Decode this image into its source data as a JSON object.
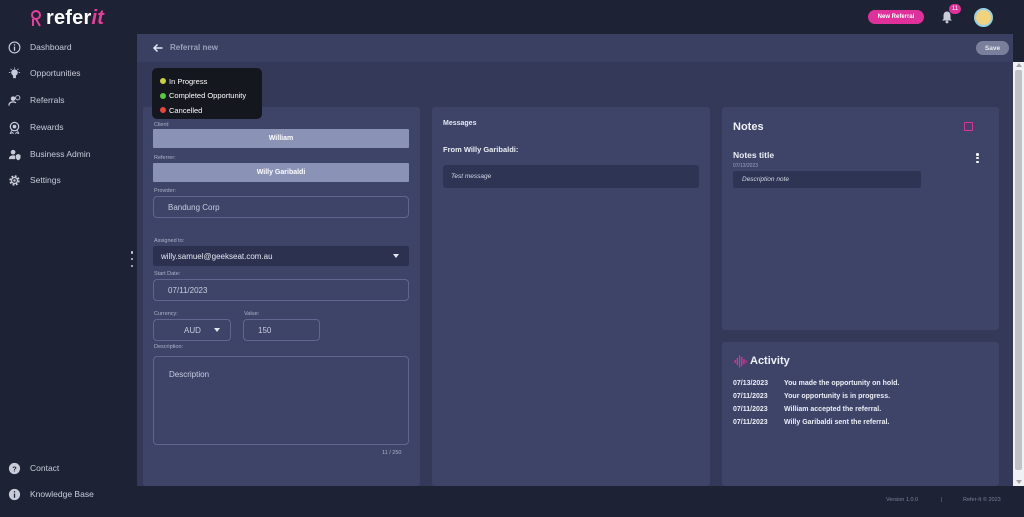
{
  "app": {
    "logo_main": "refer",
    "logo_accent": "it",
    "new_referral_label": "New Referral",
    "notification_count": "11"
  },
  "sidebar": {
    "items": [
      {
        "label": "Dashboard",
        "icon": "info-circle-icon"
      },
      {
        "label": "Opportunities",
        "icon": "lightbulb-icon"
      },
      {
        "label": "Referrals",
        "icon": "person-refresh-icon"
      },
      {
        "label": "Rewards",
        "icon": "award-icon"
      },
      {
        "label": "Business Admin",
        "icon": "shield-person-icon"
      },
      {
        "label": "Settings",
        "icon": "gear-icon"
      }
    ],
    "bottom_items": [
      {
        "label": "Contact",
        "icon": "question-circle-icon"
      },
      {
        "label": "Knowledge Base",
        "icon": "info-circle-icon"
      }
    ]
  },
  "header": {
    "title": "Referral new",
    "save_label": "Save"
  },
  "status_legend": [
    {
      "label": "In Progress",
      "color": "#c8d23a"
    },
    {
      "label": "Completed Opportunity",
      "color": "#5ac83a"
    },
    {
      "label": "Cancelled",
      "color": "#e8453c"
    }
  ],
  "form": {
    "client_label": "Client:",
    "client_value": "William",
    "referrer_label": "Referrer:",
    "referrer_value": "Willy Garibaldi",
    "provider_label": "Provider:",
    "provider_value": "Bandung Corp",
    "assigned_label": "Assigned to:",
    "assigned_value": "willy.samuel@geekseat.com.au",
    "start_date_label": "Start Date:",
    "start_date_value": "07/11/2023",
    "currency_label": "Currency:",
    "currency_value": "AUD",
    "value_label": "Value:",
    "value_value": "150",
    "description_label": "Description:",
    "description_value": "Description",
    "char_count": "11 / 250"
  },
  "messages": {
    "title": "Messages",
    "from": "From Willy Garibaldi:",
    "text": "Test message"
  },
  "notes": {
    "title": "Notes",
    "note_title": "Notes title",
    "note_date": "07/13/2023",
    "note_desc": "Description note"
  },
  "activity": {
    "title": "Activity",
    "rows": [
      {
        "date": "07/13/2023",
        "text": "You made the opportunity on hold."
      },
      {
        "date": "07/11/2023",
        "text": "Your opportunity is in progress."
      },
      {
        "date": "07/11/2023",
        "text": "William accepted the referral."
      },
      {
        "date": "07/11/2023",
        "text": "Willy Garibaldi sent the referral."
      }
    ]
  },
  "footer": {
    "version": "Version 1.0.0",
    "separator": "|",
    "copyright": "Refer-It © 2023"
  },
  "colors": {
    "accent": "#e0309a",
    "background": "#1e2235",
    "main": "#34395a",
    "panel": "#3d4468"
  }
}
